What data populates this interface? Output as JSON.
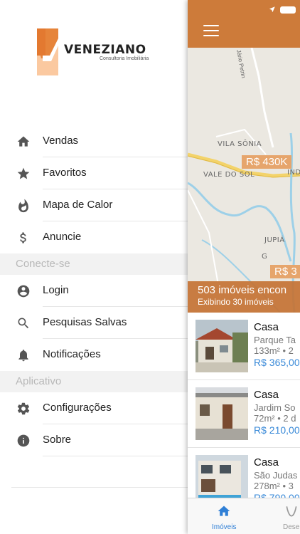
{
  "logo": {
    "brand": "VENEZIANO",
    "tagline": "Consultoria Imobiliária"
  },
  "menu": {
    "items": [
      {
        "label": "Vendas",
        "icon": "home-icon"
      },
      {
        "label": "Favoritos",
        "icon": "star-icon"
      },
      {
        "label": "Mapa de Calor",
        "icon": "flame-icon"
      },
      {
        "label": "Anuncie",
        "icon": "dollar-icon"
      }
    ],
    "section_connect": "Conecte-se",
    "connect_items": [
      {
        "label": "Login",
        "icon": "account-icon"
      },
      {
        "label": "Pesquisas Salvas",
        "icon": "search-icon"
      },
      {
        "label": "Notificações",
        "icon": "bell-icon"
      }
    ],
    "section_app": "Aplicativo",
    "app_items": [
      {
        "label": "Configurações",
        "icon": "gear-icon"
      },
      {
        "label": "Sobre",
        "icon": "info-icon"
      }
    ]
  },
  "map": {
    "street": "Jário Petrin",
    "labels": [
      "VILA SÔNIA",
      "VALE DO SOL",
      "IND",
      "JUPIÁ",
      "G"
    ],
    "prices": [
      "R$ 430K",
      "R$ 3"
    ]
  },
  "results": {
    "count_text": "503 imóveis encon",
    "showing_text": "Exibindo 30 imóveis"
  },
  "listings": [
    {
      "title": "Casa",
      "location": "Parque Ta",
      "specs": "133m² • 2",
      "price": "R$ 365,00"
    },
    {
      "title": "Casa",
      "location": "Jardim So",
      "specs": "72m² • 2 d",
      "price": "R$ 210,00"
    },
    {
      "title": "Casa",
      "location": "São Judas",
      "specs": "278m² • 3",
      "price": "R$ 790,00"
    }
  ],
  "tabs": [
    {
      "label": "Imóveis",
      "icon": "home-icon",
      "active": true
    },
    {
      "label": "Dese",
      "icon": "wish-icon",
      "active": false
    }
  ],
  "colors": {
    "brand": "#cd7b3a",
    "price": "#3a8ad8",
    "tab_active": "#2f7fd6",
    "logo": "#e38b3f"
  }
}
